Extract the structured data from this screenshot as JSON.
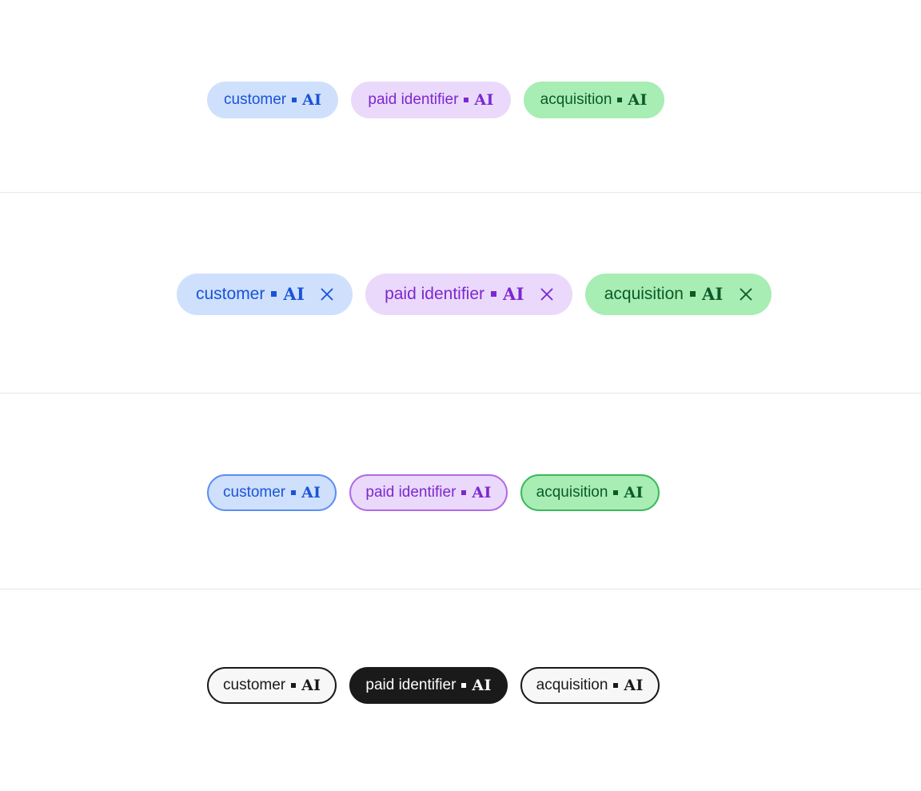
{
  "theme": {
    "background": "#ffffff",
    "divider": "#e6e6e6"
  },
  "tag_text": {
    "separator": "square-bullet",
    "suffix": "AI"
  },
  "palette": {
    "blue": {
      "solid_bg": "#cfe0fd",
      "solid_fg": "#1a53d8",
      "border": "#5b8ef5"
    },
    "purple": {
      "solid_bg": "#ead9fb",
      "solid_fg": "#7c28d0",
      "border": "#b06ae8"
    },
    "green": {
      "solid_bg": "#a7edb4",
      "solid_fg": "#0c5a28",
      "border": "#3cb85c"
    },
    "neutral": {
      "unselected_bg": "#f7f7f7",
      "unselected_fg": "#1a1a1a",
      "selected_bg": "#1a1a1a",
      "selected_fg": "#ffffff",
      "border": "#1a1a1a"
    }
  },
  "sections": [
    {
      "name": "solid-tags",
      "chips": [
        {
          "label": "customer",
          "suffix": "AI",
          "color": "blue"
        },
        {
          "label": "paid identifier",
          "suffix": "AI",
          "color": "purple"
        },
        {
          "label": "acquisition",
          "suffix": "AI",
          "color": "green"
        }
      ]
    },
    {
      "name": "dismissible-tags",
      "chips": [
        {
          "label": "customer",
          "suffix": "AI",
          "color": "blue",
          "close_icon": "close-icon"
        },
        {
          "label": "paid identifier",
          "suffix": "AI",
          "color": "purple",
          "close_icon": "close-icon"
        },
        {
          "label": "acquisition",
          "suffix": "AI",
          "color": "green",
          "close_icon": "close-icon"
        }
      ]
    },
    {
      "name": "outlined-tags",
      "chips": [
        {
          "label": "customer",
          "suffix": "AI",
          "color": "blue"
        },
        {
          "label": "paid identifier",
          "suffix": "AI",
          "color": "purple"
        },
        {
          "label": "acquisition",
          "suffix": "AI",
          "color": "green"
        }
      ]
    },
    {
      "name": "toggle-tags",
      "chips": [
        {
          "label": "customer",
          "suffix": "AI",
          "state": "unselected"
        },
        {
          "label": "paid identifier",
          "suffix": "AI",
          "state": "selected"
        },
        {
          "label": "acquisition",
          "suffix": "AI",
          "state": "unselected"
        }
      ]
    }
  ]
}
